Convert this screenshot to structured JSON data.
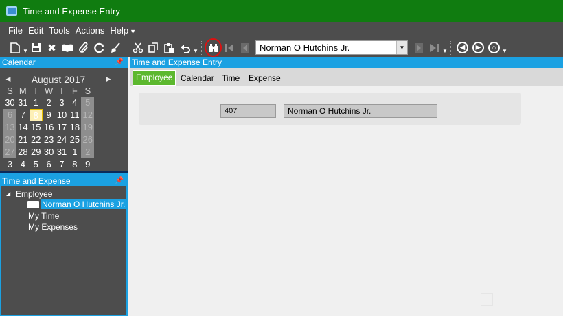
{
  "window": {
    "title": "Time and Expense Entry"
  },
  "menu": {
    "items": [
      "File",
      "Edit",
      "Tools",
      "Actions",
      "Help"
    ]
  },
  "toolbar": {
    "employee_value": "Norman O Hutchins Jr."
  },
  "calendar_panel": {
    "title": "Calendar",
    "month_label": "August 2017",
    "weekdays": [
      "S",
      "M",
      "T",
      "W",
      "T",
      "F",
      "S"
    ],
    "weeks": [
      [
        "30",
        "31",
        "1",
        "2",
        "3",
        "4",
        "5"
      ],
      [
        "6",
        "7",
        "8",
        "9",
        "10",
        "11",
        "12"
      ],
      [
        "13",
        "14",
        "15",
        "16",
        "17",
        "18",
        "19"
      ],
      [
        "20",
        "21",
        "22",
        "23",
        "24",
        "25",
        "26"
      ],
      [
        "27",
        "28",
        "29",
        "30",
        "31",
        "1",
        "2"
      ],
      [
        "3",
        "4",
        "5",
        "6",
        "7",
        "8",
        "9"
      ]
    ]
  },
  "te_panel": {
    "title": "Time and Expense",
    "root": "Employee",
    "employee": "Norman O Hutchins Jr.",
    "my_time": "My Time",
    "my_expenses": "My Expenses"
  },
  "main": {
    "title": "Time and Expense Entry",
    "tabs": [
      "Employee",
      "Calendar",
      "Time",
      "Expense"
    ],
    "employee_id": "407",
    "employee_name": "Norman O Hutchins Jr."
  },
  "colors": {
    "titlebar": "#107c10",
    "accent": "#1ba1e2",
    "tab_active": "#5cb82e",
    "chrome": "#4d4d4d"
  }
}
